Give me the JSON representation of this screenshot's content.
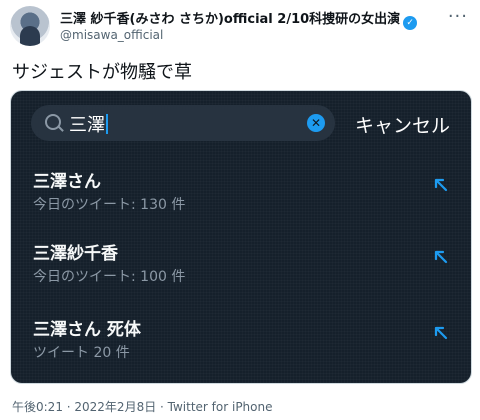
{
  "tweet": {
    "author_name": "三澤 紗千香(みさわ さちか)official 2/10科捜研の女出演",
    "handle": "@misawa_official",
    "text": "サジェストが物騒で草",
    "footer": "午後0:21 · 2022年2月8日 · Twitter for iPhone"
  },
  "search": {
    "query": "三澤",
    "cancel_label": "キャンセル"
  },
  "suggestions": [
    {
      "title": "三澤さん",
      "subtitle": "今日のツイート: 130 件"
    },
    {
      "title": "三澤紗千香",
      "subtitle": "今日のツイート: 100 件"
    },
    {
      "title": "三澤さん 死体",
      "subtitle": "ツイート 20 件"
    }
  ],
  "colors": {
    "accent": "#1d9bf0",
    "dark_bg": "#15202b"
  },
  "icons": {
    "verified": "verified-badge-icon",
    "more": "more-icon",
    "search": "search-icon",
    "clear": "clear-icon",
    "fill": "arrow-up-left-icon"
  }
}
